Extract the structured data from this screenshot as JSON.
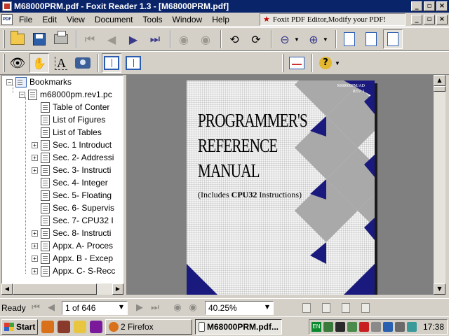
{
  "window": {
    "title": "M68000PRM.pdf - Foxit Reader 1.3 - [M68000PRM.pdf]",
    "minimize_glyph": "_",
    "maximize_glyph": "▫",
    "close_glyph": "×"
  },
  "menu": {
    "items": [
      "File",
      "Edit",
      "View",
      "Document",
      "Tools",
      "Window",
      "Help"
    ],
    "ad_text": "Foxit PDF Editor,Modify your PDF!"
  },
  "toolbar1": {
    "buttons": [
      "open-icon",
      "save-icon",
      "print-icon",
      "first-page-icon",
      "prev-page-icon",
      "next-page-icon",
      "last-page-icon",
      "back-icon",
      "forward-icon",
      "rotate-left-icon",
      "rotate-right-icon",
      "zoom-out-icon",
      "zoom-in-icon",
      "actual-size-icon",
      "fit-page-icon",
      "fit-width-icon"
    ]
  },
  "toolbar2": {
    "buttons": [
      "find-icon",
      "hand-tool-icon",
      "text-select-icon",
      "snapshot-icon",
      "bookmarks-panel-icon",
      "thumbnails-panel-icon",
      "sign-icon",
      "help-icon"
    ]
  },
  "bookmarks": {
    "root": "Bookmarks",
    "document": "m68000pm.rev1.pc",
    "items": [
      {
        "label": "Table of Conter",
        "expandable": false
      },
      {
        "label": "List of Figures",
        "expandable": false
      },
      {
        "label": "List of Tables",
        "expandable": false
      },
      {
        "label": "Sec. 1 Introduct",
        "expandable": true
      },
      {
        "label": "Sec. 2- Addressi",
        "expandable": true
      },
      {
        "label": "Sec. 3- Instructi",
        "expandable": true
      },
      {
        "label": "Sec. 4- Integer",
        "expandable": false
      },
      {
        "label": "Sec. 5- Floating",
        "expandable": false
      },
      {
        "label": "Sec. 6- Supervis",
        "expandable": false
      },
      {
        "label": "Sec. 7- CPU32 I",
        "expandable": false
      },
      {
        "label": "Sec. 8- Instructi",
        "expandable": true
      },
      {
        "label": "Appx. A- Proces",
        "expandable": true
      },
      {
        "label": "Appx. B - Excep",
        "expandable": true
      },
      {
        "label": "Appx. C- S-Recc",
        "expandable": true
      }
    ]
  },
  "page_content": {
    "code_line1": "M68000PM/AD",
    "code_line2": "REV. 1",
    "title_line1": "PROGRAMMER'S",
    "title_line2": "REFERENCE",
    "title_line3": "MANUAL",
    "subtitle_pre": "(Includes ",
    "subtitle_bold": "CPU32",
    "subtitle_post": " Instructions)",
    "accent_color": "#1a1a7e"
  },
  "statusbar": {
    "status": "Ready",
    "page_indicator": "1 of 646",
    "zoom": "40.25%"
  },
  "taskbar": {
    "start_label": "Start",
    "tasks": [
      {
        "label": "2 Firefox",
        "active": false
      },
      {
        "label": "M68000PRM.pdf...",
        "active": true
      }
    ],
    "tray_lang": "EN",
    "clock": "17:38"
  }
}
